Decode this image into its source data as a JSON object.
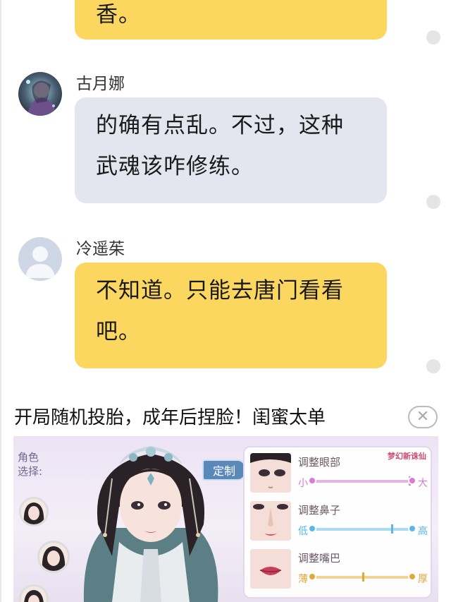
{
  "messages": [
    {
      "sender": "",
      "text_lines": [
        "香。"
      ],
      "style": "yellow"
    },
    {
      "sender": "古月娜",
      "text_lines": [
        "的确有点乱。不过，这种",
        "武魂该咋修练。"
      ],
      "style": "gray"
    },
    {
      "sender": "冷遥茱",
      "text_lines": [
        "不知道。只能去唐门看看",
        "吧。"
      ],
      "style": "yellow"
    }
  ],
  "ad": {
    "title": "开局随机投胎，成年后捏脸！闺蜜太单",
    "close_symbol": "✕",
    "side_label_lines": [
      "角色",
      "选择:"
    ],
    "customize_label": "定制",
    "logo_text": "梦幻新诛仙",
    "sliders": [
      {
        "title": "调整眼部",
        "low": "小",
        "high": "大",
        "color": "#d87ad8",
        "value": 0.95
      },
      {
        "title": "调整鼻子",
        "low": "低",
        "high": "高",
        "color": "#5ab7e8",
        "value": 0.78
      },
      {
        "title": "调整嘴巴",
        "low": "薄",
        "high": "厚",
        "color": "#e0a93a",
        "value": 0.5
      }
    ]
  },
  "colors": {
    "yellow_bubble": "#fbd760",
    "gray_bubble": "#e3e6ee",
    "read_dot": "#e5e5e5"
  }
}
